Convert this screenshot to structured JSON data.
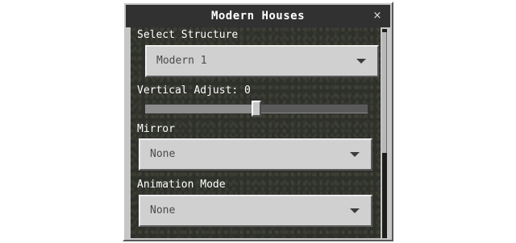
{
  "dialog": {
    "title": "Modern Houses",
    "close_glyph": "×"
  },
  "fields": {
    "structure": {
      "label": "Select Structure",
      "value": "Modern 1"
    },
    "vertical_adjust": {
      "label": "Vertical Adjust: 0",
      "value": 0,
      "fraction": 0.5
    },
    "mirror": {
      "label": "Mirror",
      "value": "None"
    },
    "animation_mode": {
      "label": "Animation Mode",
      "value": "None"
    }
  },
  "icons": {
    "close": "close-icon",
    "dropdown": "chevron-down-icon"
  }
}
